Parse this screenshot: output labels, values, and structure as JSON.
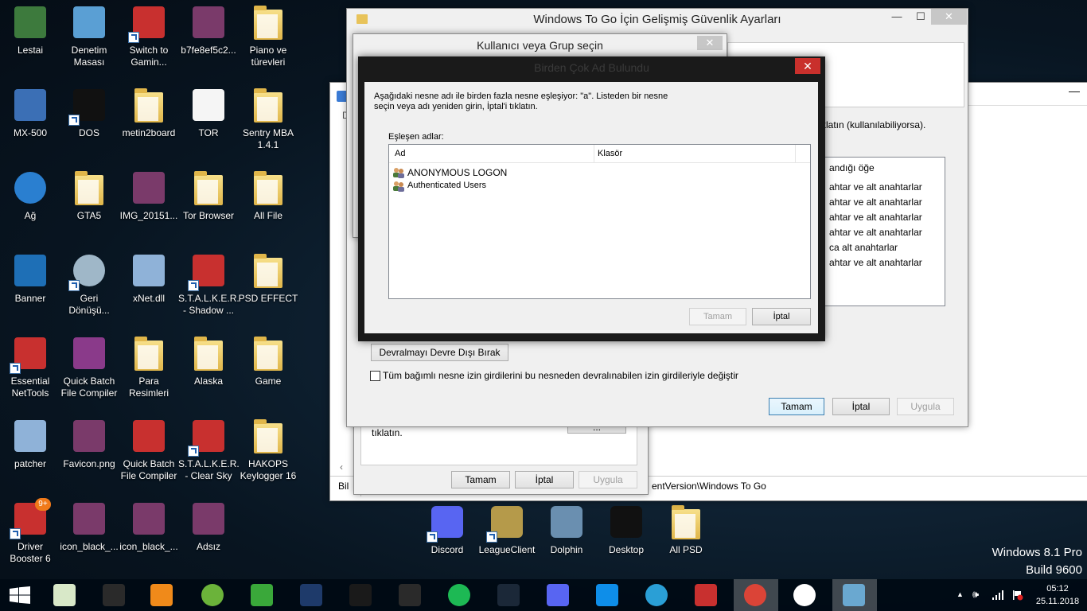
{
  "desktop": {
    "icons": [
      {
        "label": "Lestai"
      },
      {
        "label": "Denetim\nMasası"
      },
      {
        "label": "Switch to\nGamin..."
      },
      {
        "label": "b7fe8ef5c2..."
      },
      {
        "label": "Piano ve\ntürevleri"
      },
      {
        "label": "MX-500"
      },
      {
        "label": "DOS"
      },
      {
        "label": "metin2board"
      },
      {
        "label": "TOR"
      },
      {
        "label": "Sentry MBA\n1.4.1"
      },
      {
        "label": "Ağ"
      },
      {
        "label": "GTA5"
      },
      {
        "label": "IMG_20151..."
      },
      {
        "label": "Tor Browser"
      },
      {
        "label": "All File"
      },
      {
        "label": "Banner"
      },
      {
        "label": "Geri\nDönüşü..."
      },
      {
        "label": "xNet.dll"
      },
      {
        "label": "S.T.A.L.K.E.R.\n- Shadow ..."
      },
      {
        "label": "PSD EFFECT"
      },
      {
        "label": "Essential\nNetTools"
      },
      {
        "label": "Quick Batch\nFile Compiler"
      },
      {
        "label": "Para\nResimleri"
      },
      {
        "label": "Alaska"
      },
      {
        "label": "Game"
      },
      {
        "label": "patcher"
      },
      {
        "label": "Favicon.png"
      },
      {
        "label": "Quick Batch\nFile Compiler"
      },
      {
        "label": "S.T.A.L.K.E.R.\n- Clear Sky"
      },
      {
        "label": "HAKOPS\nKeylogger 16"
      },
      {
        "label": "Driver\nBooster 6"
      },
      {
        "label": "icon_black_..."
      },
      {
        "label": "icon_black_..."
      },
      {
        "label": "Adsız"
      },
      {
        "label": "Discord"
      },
      {
        "label": "LeagueClient"
      },
      {
        "label": "Dolphin"
      },
      {
        "label": "Desktop"
      },
      {
        "label": "All PSD"
      }
    ],
    "driver_badge": "9+",
    "watermark_line1": "Windows 8.1 Pro",
    "watermark_line2": "Build 9600"
  },
  "back_window": {
    "text_fragment_1": "klatın (kullanılabiliyorsa).",
    "column_header_fragment": "andığı öğe",
    "rows": [
      "ahtar ve alt anahtarlar",
      "ahtar ve alt anahtarlar",
      "ahtar ve alt anahtarlar",
      "ahtar ve alt anahtarlar",
      "ca alt anahtarlar",
      "ahtar ve alt anahtarlar"
    ],
    "status_left": "Bil",
    "status_path": "entVersion\\Windows To Go",
    "menu_fragment": "D",
    "left_text": "tıklatın.",
    "ok": "Tamam",
    "cancel": "İptal",
    "apply": "Uygula"
  },
  "security_window": {
    "title": "Windows To Go İçin Gelişmiş Güvenlik Ayarları",
    "disable_inheritance": "Devralmayı Devre Dışı Bırak",
    "replace_checkbox": "Tüm bağımlı nesne izin girdilerini bu nesneden devralınabilen izin girdileriyle değiştir",
    "ok": "Tamam",
    "cancel": "İptal",
    "apply": "Uygula"
  },
  "select_user_window": {
    "title": "Kullanıcı veya Grup seçin"
  },
  "multiple_names_dialog": {
    "title": "Birden Çok Ad Bulundu",
    "message_line1": "Aşağıdaki nesne adı ile birden fazla nesne eşleşiyor: \"a\". Listeden bir nesne",
    "message_line2": "seçin veya adı yeniden girin, İptal'i tıklatın.",
    "matching_label": "Eşleşen adlar:",
    "columns": [
      "Ad",
      "Klasör"
    ],
    "items": [
      "ANONYMOUS LOGON",
      "Authenticated Users"
    ],
    "ok": "Tamam",
    "cancel": "İptal"
  },
  "taskbar": {
    "clock_time": "05:12",
    "clock_date": "25.11.2018",
    "up_arrow": "▲"
  },
  "colors": {
    "close_red": "#c9302c",
    "dialog_frame": "#1a1a1a",
    "accent_blue": "#3c7fb1"
  }
}
